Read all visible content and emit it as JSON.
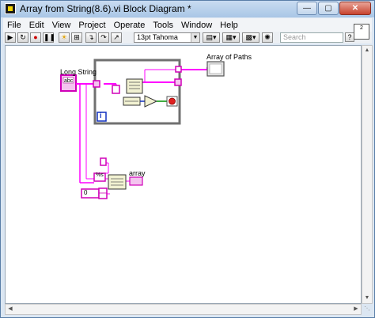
{
  "window": {
    "title": "Array from String(8.6).vi Block Diagram *"
  },
  "window_buttons": {
    "minimize": "—",
    "maximize": "▢",
    "close": "✕"
  },
  "menu": [
    "File",
    "Edit",
    "View",
    "Project",
    "Operate",
    "Tools",
    "Window",
    "Help"
  ],
  "toolbar": {
    "font": "13pt Tahoma",
    "search_placeholder": "Search",
    "help": "?"
  },
  "connector_pane": {
    "label": "2"
  },
  "diagram": {
    "long_string_label": "Long String",
    "long_string_terminal": "abc",
    "array_of_paths_label": "Array of Paths",
    "array_label": "array",
    "info_terminal": "i",
    "format_spec": "%s",
    "initial_value": "0"
  }
}
